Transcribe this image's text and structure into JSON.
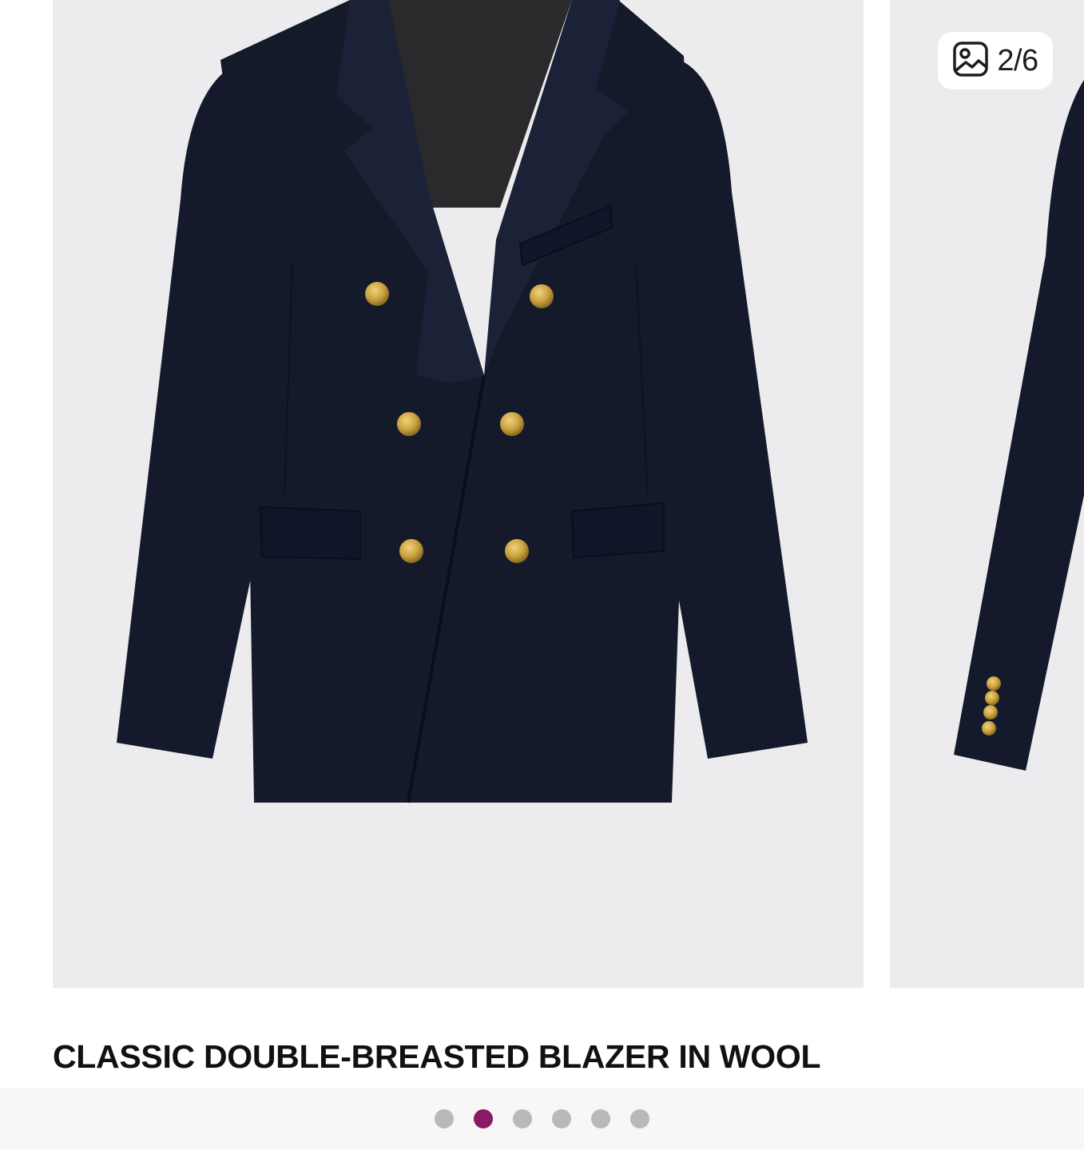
{
  "gallery": {
    "counter": "2/6",
    "counter_icon": "image-gallery-icon",
    "current_index": 2,
    "total": 6
  },
  "product": {
    "title": "CLASSIC DOUBLE-BREASTED BLAZER IN WOOL"
  },
  "pagination": {
    "dots": [
      {
        "active": false
      },
      {
        "active": true
      },
      {
        "active": false
      },
      {
        "active": false
      },
      {
        "active": false
      },
      {
        "active": false
      }
    ],
    "active_color": "#8b1a64",
    "inactive_color": "#b9b9b9"
  },
  "colors": {
    "photo_background": "#ececee",
    "blazer": "#151a2b",
    "buttons": "#c9a23f"
  }
}
